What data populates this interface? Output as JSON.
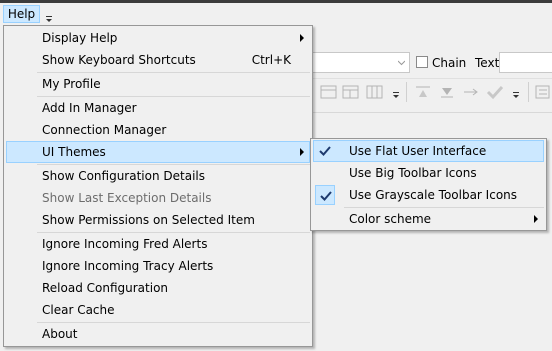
{
  "menubar": {
    "help_label": "Help"
  },
  "background": {
    "chain_label": "Chain",
    "text_label": "Text"
  },
  "help_menu": {
    "items": [
      {
        "label": "Display Help",
        "has_submenu": true
      },
      {
        "label": "Show Keyboard Shortcuts",
        "shortcut": "Ctrl+K"
      },
      {
        "label": "My Profile"
      },
      {
        "label": "Add In Manager"
      },
      {
        "label": "Connection Manager"
      },
      {
        "label": "UI Themes",
        "has_submenu": true,
        "highlighted": true
      },
      {
        "label": "Show Configuration Details"
      },
      {
        "label": "Show Last Exception Details",
        "disabled": true
      },
      {
        "label": "Show Permissions on Selected Item"
      },
      {
        "label": "Ignore Incoming Fred Alerts"
      },
      {
        "label": "Ignore Incoming Tracy Alerts"
      },
      {
        "label": "Reload Configuration"
      },
      {
        "label": "Clear Cache"
      },
      {
        "label": "About"
      }
    ]
  },
  "themes_submenu": {
    "items": [
      {
        "label": "Use Flat User Interface",
        "checked": true,
        "highlighted": true
      },
      {
        "label": "Use Big Toolbar Icons",
        "checked": false
      },
      {
        "label": "Use Grayscale Toolbar Icons",
        "checked": true
      },
      {
        "label": "Color scheme",
        "has_submenu": true
      }
    ]
  },
  "colors": {
    "highlight_bg": "#cce8ff",
    "highlight_border": "#99d1ff",
    "menu_bg": "#f0f0f0",
    "check_color": "#1e3a6e"
  },
  "icons": {
    "submenu_arrow": "chevron-right-icon",
    "checkmark": "checkmark-icon"
  }
}
